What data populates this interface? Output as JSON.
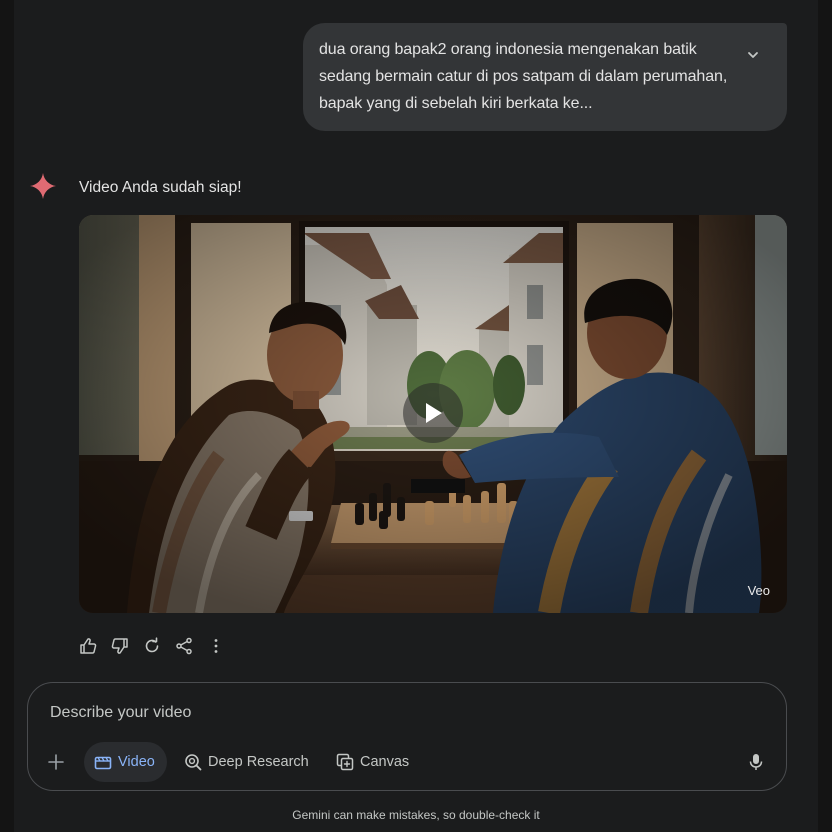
{
  "user_message": {
    "text": "dua orang bapak2 orang indonesia mengenakan batik sedang bermain catur di pos satpam di dalam perumahan, bapak yang di sebelah kiri berkata ke...",
    "expand_icon": "chevron-down-icon"
  },
  "response": {
    "avatar_icon": "gemini-sparkle-icon",
    "title": "Video Anda sudah siap!",
    "video": {
      "watermark": "Veo",
      "play_icon": "play-icon"
    },
    "actions": [
      {
        "name": "thumbs-up-icon"
      },
      {
        "name": "thumbs-down-icon"
      },
      {
        "name": "regenerate-icon"
      },
      {
        "name": "share-icon"
      },
      {
        "name": "more-options-icon"
      }
    ]
  },
  "composer": {
    "placeholder": "Describe your video",
    "tools": {
      "video_label": "Video",
      "deep_research_label": "Deep Research",
      "canvas_label": "Canvas"
    }
  },
  "footer": {
    "disclaimer": "Gemini can make mistakes, so double-check it"
  },
  "colors": {
    "background": "#1b1c1d",
    "bubble": "#333537",
    "accent": "#8ab4f8",
    "sparkle": "#e06b73"
  }
}
